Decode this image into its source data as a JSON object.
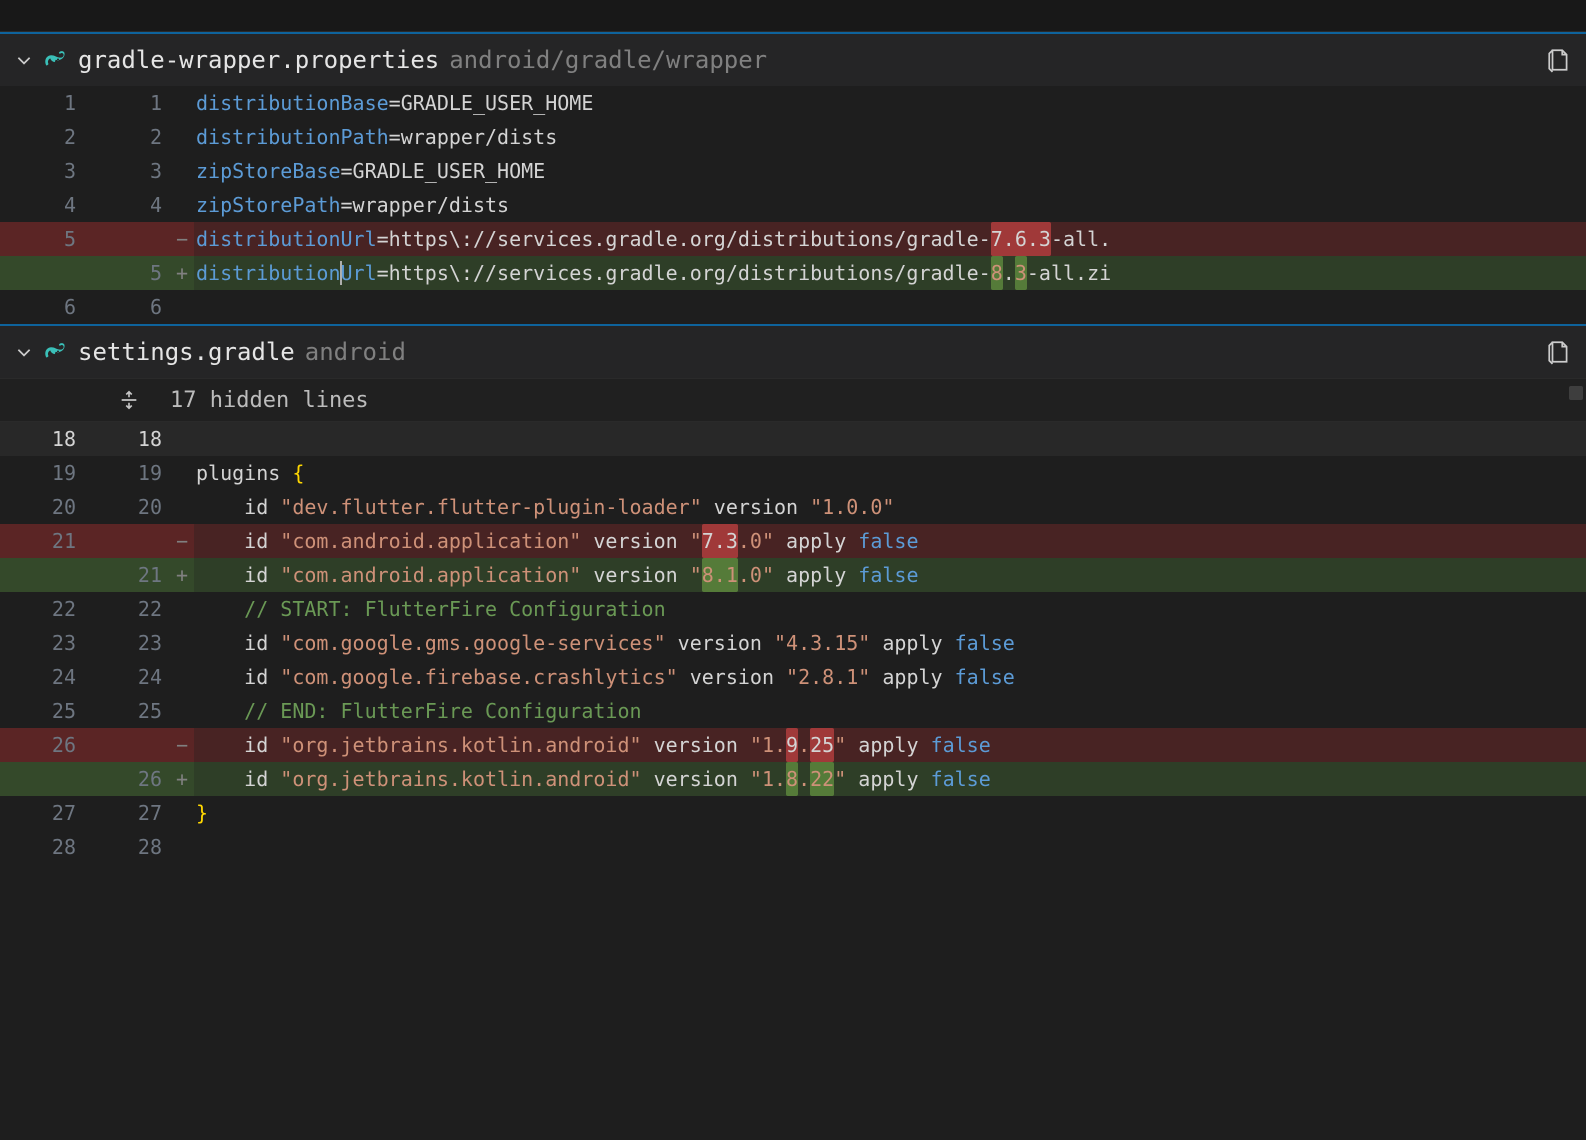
{
  "files": [
    {
      "name": "gradle-wrapper.properties",
      "path": "android/gradle/wrapper",
      "lines": [
        {
          "old": "1",
          "new": "1",
          "mark": "",
          "type": "ctx",
          "tokens": [
            [
              "key",
              "distributionBase"
            ],
            [
              "op",
              "="
            ],
            [
              "val",
              "GRADLE_USER_HOME"
            ]
          ]
        },
        {
          "old": "2",
          "new": "2",
          "mark": "",
          "type": "ctx",
          "tokens": [
            [
              "key",
              "distributionPath"
            ],
            [
              "op",
              "="
            ],
            [
              "val",
              "wrapper/dists"
            ]
          ]
        },
        {
          "old": "3",
          "new": "3",
          "mark": "",
          "type": "ctx",
          "tokens": [
            [
              "key",
              "zipStoreBase"
            ],
            [
              "op",
              "="
            ],
            [
              "val",
              "GRADLE_USER_HOME"
            ]
          ]
        },
        {
          "old": "4",
          "new": "4",
          "mark": "",
          "type": "ctx",
          "tokens": [
            [
              "key",
              "zipStorePath"
            ],
            [
              "op",
              "="
            ],
            [
              "val",
              "wrapper/dists"
            ]
          ]
        },
        {
          "old": "5",
          "new": "",
          "mark": "−",
          "type": "del",
          "tokens": [
            [
              "key",
              "distributionUrl"
            ],
            [
              "op",
              "="
            ],
            [
              "val",
              "https\\://services.gradle.org/distributions/gradle-"
            ],
            [
              "hl-del",
              "7.6.3"
            ],
            [
              "val",
              "-all."
            ]
          ]
        },
        {
          "old": "",
          "new": "5",
          "mark": "+",
          "type": "add",
          "cursor": true,
          "tokens": [
            [
              "key",
              "distribution"
            ],
            [
              "cursor",
              ""
            ],
            [
              "key",
              "Url"
            ],
            [
              "op",
              "="
            ],
            [
              "val",
              "https\\://services.gradle.org/distributions/gradle-"
            ],
            [
              "hl-add",
              "8"
            ],
            [
              "val",
              "."
            ],
            [
              "hl-add",
              "3"
            ],
            [
              "val",
              "-all.zi"
            ]
          ]
        },
        {
          "old": "6",
          "new": "6",
          "mark": "",
          "type": "ctx",
          "tokens": []
        }
      ]
    },
    {
      "name": "settings.gradle",
      "path": "android",
      "hidden_lines_label": "17 hidden lines",
      "lines": [
        {
          "old": "18",
          "new": "18",
          "mark": "",
          "type": "ctx",
          "current": true,
          "tokens": []
        },
        {
          "old": "19",
          "new": "19",
          "mark": "",
          "type": "ctx",
          "tokens": [
            [
              "id",
              "plugins "
            ],
            [
              "br",
              "{"
            ]
          ]
        },
        {
          "old": "20",
          "new": "20",
          "mark": "",
          "type": "ctx",
          "tokens": [
            [
              "id",
              "    id "
            ],
            [
              "str",
              "\"dev.flutter.flutter-plugin-loader\""
            ],
            [
              "id",
              " version "
            ],
            [
              "str",
              "\"1.0.0\""
            ]
          ]
        },
        {
          "old": "21",
          "new": "",
          "mark": "−",
          "type": "del",
          "tokens": [
            [
              "id",
              "    id "
            ],
            [
              "str",
              "\"com.android.application\""
            ],
            [
              "id",
              " version "
            ],
            [
              "str",
              "\""
            ],
            [
              "hl-del",
              "7.3"
            ],
            [
              "str",
              ".0\""
            ],
            [
              "id",
              " apply "
            ],
            [
              "kw",
              "false"
            ]
          ]
        },
        {
          "old": "",
          "new": "21",
          "mark": "+",
          "type": "add",
          "tokens": [
            [
              "id",
              "    id "
            ],
            [
              "str",
              "\"com.android.application\""
            ],
            [
              "id",
              " version "
            ],
            [
              "str",
              "\""
            ],
            [
              "hl-add",
              "8.1"
            ],
            [
              "str",
              ".0\""
            ],
            [
              "id",
              " apply "
            ],
            [
              "kw",
              "false"
            ]
          ]
        },
        {
          "old": "22",
          "new": "22",
          "mark": "",
          "type": "ctx",
          "tokens": [
            [
              "id",
              "    "
            ],
            [
              "cm",
              "// START: FlutterFire Configuration"
            ]
          ]
        },
        {
          "old": "23",
          "new": "23",
          "mark": "",
          "type": "ctx",
          "tokens": [
            [
              "id",
              "    id "
            ],
            [
              "str",
              "\"com.google.gms.google-services\""
            ],
            [
              "id",
              " version "
            ],
            [
              "str",
              "\"4.3.15\""
            ],
            [
              "id",
              " apply "
            ],
            [
              "kw",
              "false"
            ]
          ]
        },
        {
          "old": "24",
          "new": "24",
          "mark": "",
          "type": "ctx",
          "tokens": [
            [
              "id",
              "    id "
            ],
            [
              "str",
              "\"com.google.firebase.crashlytics\""
            ],
            [
              "id",
              " version "
            ],
            [
              "str",
              "\"2.8.1\""
            ],
            [
              "id",
              " apply "
            ],
            [
              "kw",
              "false"
            ]
          ]
        },
        {
          "old": "25",
          "new": "25",
          "mark": "",
          "type": "ctx",
          "tokens": [
            [
              "id",
              "    "
            ],
            [
              "cm",
              "// END: FlutterFire Configuration"
            ]
          ]
        },
        {
          "old": "26",
          "new": "",
          "mark": "−",
          "type": "del",
          "tokens": [
            [
              "id",
              "    id "
            ],
            [
              "str",
              "\"org.jetbrains.kotlin.android\""
            ],
            [
              "id",
              " version "
            ],
            [
              "str",
              "\"1."
            ],
            [
              "hl-del",
              "9"
            ],
            [
              "str",
              "."
            ],
            [
              "hl-del",
              "25"
            ],
            [
              "str",
              "\""
            ],
            [
              "id",
              " apply "
            ],
            [
              "kw",
              "false"
            ]
          ]
        },
        {
          "old": "",
          "new": "26",
          "mark": "+",
          "type": "add",
          "tokens": [
            [
              "id",
              "    id "
            ],
            [
              "str",
              "\"org.jetbrains.kotlin.android\""
            ],
            [
              "id",
              " version "
            ],
            [
              "str",
              "\"1."
            ],
            [
              "hl-add",
              "8"
            ],
            [
              "str",
              "."
            ],
            [
              "hl-add",
              "22"
            ],
            [
              "str",
              "\""
            ],
            [
              "id",
              " apply "
            ],
            [
              "kw",
              "false"
            ]
          ]
        },
        {
          "old": "27",
          "new": "27",
          "mark": "",
          "type": "ctx",
          "tokens": [
            [
              "br",
              "}"
            ]
          ]
        },
        {
          "old": "28",
          "new": "28",
          "mark": "",
          "type": "ctx",
          "tokens": []
        }
      ]
    }
  ]
}
